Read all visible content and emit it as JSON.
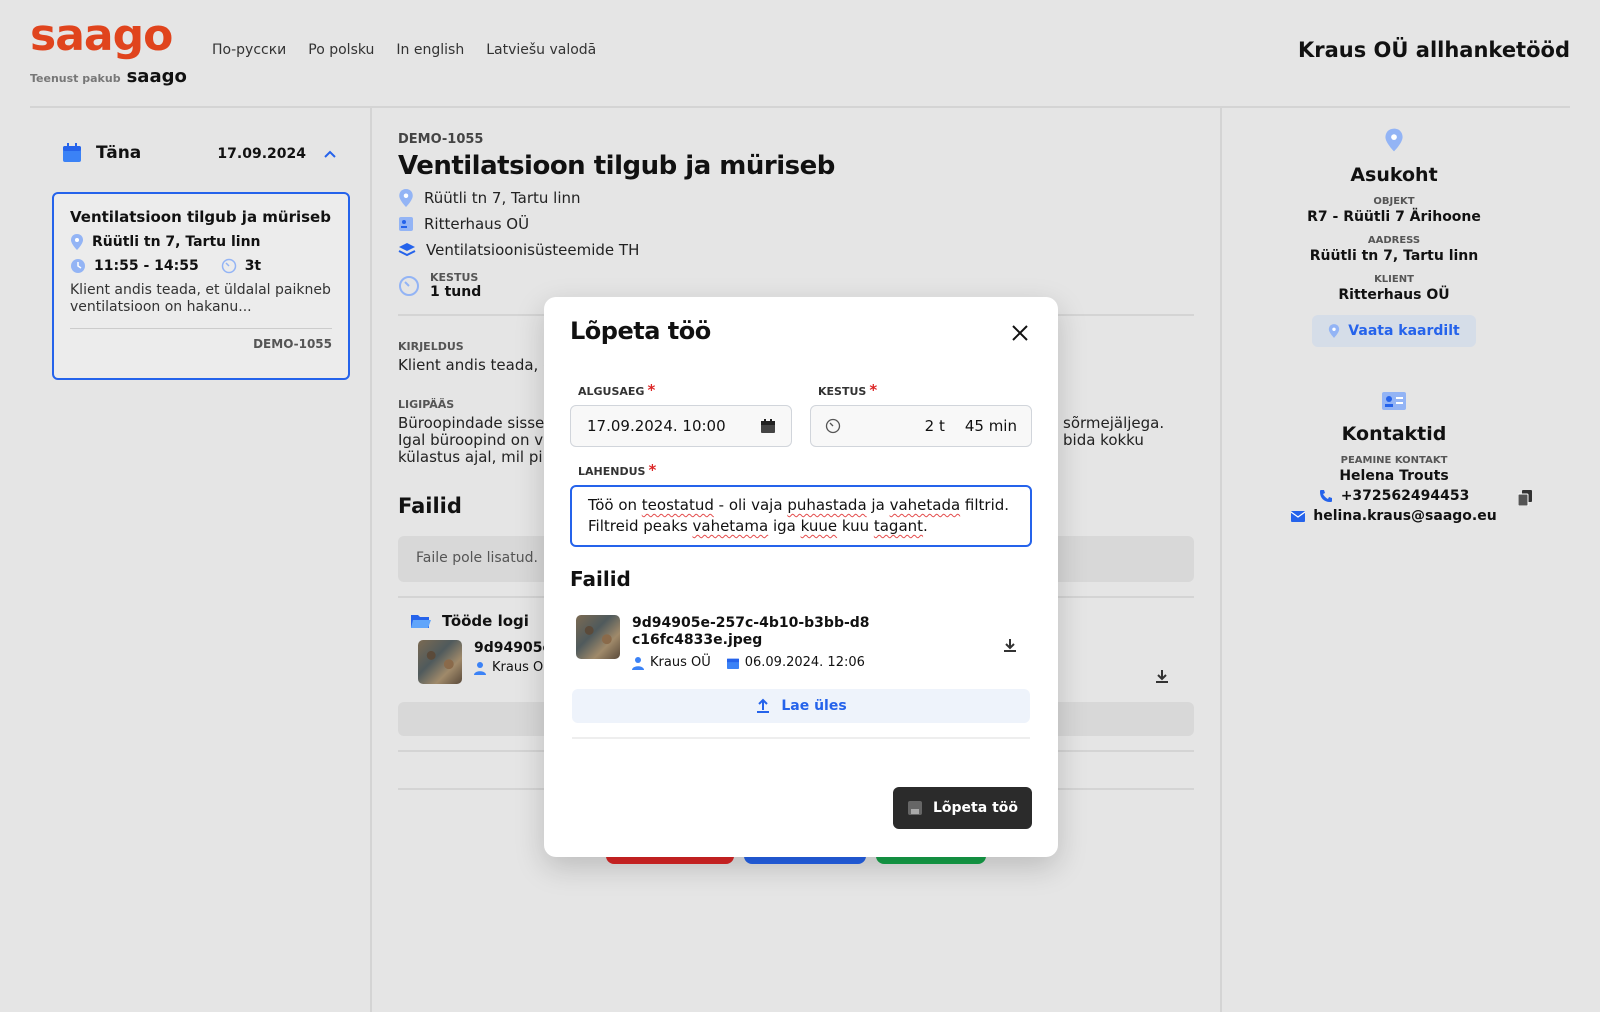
{
  "header": {
    "logo_text": "saago",
    "provided_by": "Teenust pakub",
    "provider_brand": "saago",
    "languages": [
      "По-русски",
      "Po polsku",
      "In english",
      "Latviešu valodā"
    ],
    "title": "Kraus OÜ allhanketööd"
  },
  "sidebar": {
    "day_label": "Täna",
    "date": "17.09.2024",
    "card": {
      "title": "Ventilatsioon tilgub ja müriseb",
      "address": "Rüütli tn 7, Tartu linn",
      "time": "11:55 - 14:55",
      "duration": "3t",
      "description": "Klient andis teada, et üldalal paikneb ventilatsioon on hakanu...",
      "code": "DEMO-1055"
    }
  },
  "job": {
    "id": "DEMO-1055",
    "title": "Ventilatsioon tilgub ja müriseb",
    "address": "Rüütli tn 7, Tartu linn",
    "client": "Ritterhaus OÜ",
    "service": "Ventilatsioonisüsteemide TH",
    "duration_label": "KESTUS",
    "duration_value": "1 tund",
    "description_label": "KIRJELDUS",
    "description_text": "Klient andis teada, e",
    "access_label": "LIGIPÄÄS",
    "access_line1": "Büroopindade sisse",
    "access_line1_end": "sõrmejäljega.",
    "access_line2": "Igal büroopind on v",
    "access_line2_end": "bida kokku",
    "access_line3": "külastus ajal, mil pi",
    "files_title": "Failid",
    "files_empty": "Faile pole lisatud.",
    "log_title": "Tööde logi",
    "log_file": "9d94905e",
    "log_author": "Kraus O"
  },
  "location": {
    "title": "Asukoht",
    "object_label": "OBJEKT",
    "object_value": "R7 - Rüütli 7 Ärihoone",
    "address_label": "AADRESS",
    "address_value": "Rüütli tn 7, Tartu linn",
    "client_label": "KLIENT",
    "client_value": "Ritterhaus OÜ",
    "map_button": "Vaata kaardilt"
  },
  "contacts": {
    "title": "Kontaktid",
    "main_label": "PEAMINE KONTAKT",
    "name": "Helena Trouts",
    "phone": "+372562494453",
    "email": "helina.kraus@saago.eu"
  },
  "modal": {
    "title": "Lõpeta töö",
    "start_label": "ALGUSAEG",
    "start_value": "17.09.2024. 10:00",
    "duration_label": "KESTUS",
    "duration_hours": "2 t",
    "duration_minutes": "45 min",
    "solution_label": "LAHENDUS",
    "solution_parts": [
      "Töö on ",
      "teostatud",
      " - oli vaja ",
      "puhastada",
      " ja ",
      "vahetada",
      " filtrid. Filtreid peaks ",
      "vahetama",
      " iga ",
      "kuue",
      " kuu ",
      "tagant",
      "."
    ],
    "files_title": "Failid",
    "file_name": "9d94905e-257c-4b10-b3bb-d8c16fc4833e.jpeg",
    "file_author": "Kraus OÜ",
    "file_date": "06.09.2024. 12:06",
    "upload_label": "Lae üles",
    "finish_button": "Lõpeta töö"
  },
  "colors": {
    "brand": "#e0441d",
    "accent": "#2563eb",
    "required": "#dc2626",
    "dark_button": "#2b2b2b"
  }
}
